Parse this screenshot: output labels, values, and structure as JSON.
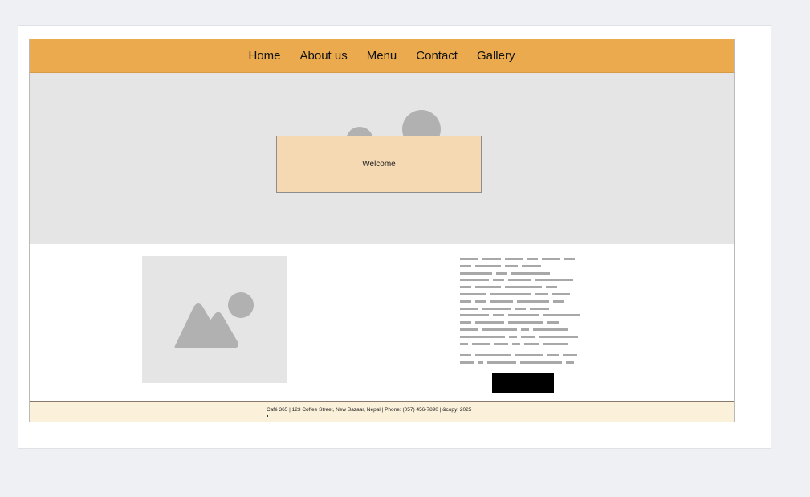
{
  "nav": {
    "items": [
      {
        "label": "Home"
      },
      {
        "label": "About us"
      },
      {
        "label": "Menu"
      },
      {
        "label": "Contact"
      },
      {
        "label": "Gallery"
      }
    ]
  },
  "hero": {
    "welcome_text": "Welcome"
  },
  "footer": {
    "text": "Café 365 | 123 Coffee Street, New Bazaar, Nepal | Phone: (057) 456-7890 | &copy; 2025"
  },
  "colors": {
    "nav_bg": "#ebaa4e",
    "hero_bg": "#e5e5e5",
    "welcome_bg": "#f5d9b2",
    "footer_bg": "#fbf1db",
    "button": "#000000"
  },
  "icons": {
    "hero_image": "image-placeholder-icon",
    "content_image": "image-placeholder-icon"
  }
}
